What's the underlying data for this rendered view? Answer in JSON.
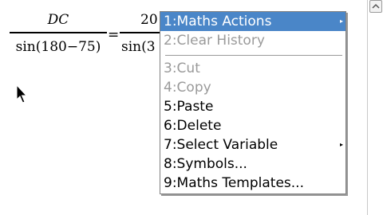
{
  "math": {
    "frac1_num": "DC",
    "frac1_den": "sin(180−75)",
    "equals": "=",
    "frac2_num": "20",
    "frac2_den": "sin(3"
  },
  "menu": {
    "items": [
      {
        "label": "1:Maths Actions",
        "submenu": true
      },
      {
        "label": "2:Clear History"
      },
      {
        "label": "3:Cut"
      },
      {
        "label": "4:Copy"
      },
      {
        "label": "5:Paste"
      },
      {
        "label": "6:Delete"
      },
      {
        "label": "7:Select Variable",
        "submenu": true
      },
      {
        "label": "8:Symbols..."
      },
      {
        "label": "9:Maths Templates..."
      }
    ],
    "submenu_arrow": "▸"
  },
  "icons": {
    "pointer": "mouse-pointer-icon",
    "scroll_up": "scroll-up-icon"
  },
  "colors": {
    "selection": "#4a86c8",
    "disabled_text": "#9a9a9a"
  }
}
